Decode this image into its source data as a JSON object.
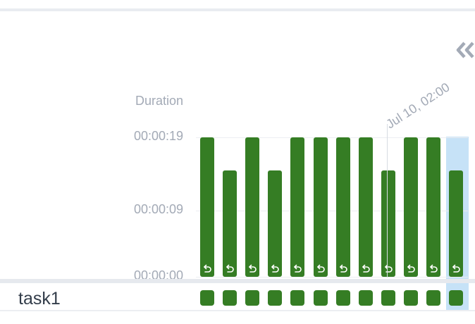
{
  "panel": {
    "collapse_icon": "double-chevron-left-icon",
    "duration_label": "Duration",
    "hover_date": "Jul 10, 02:00",
    "task_name": "task1",
    "retry_icon": "retry-icon"
  },
  "colors": {
    "success": "#357d24",
    "selection": "#c6e2f7",
    "muted_text": "#a3aab6"
  },
  "chart_data": {
    "type": "bar",
    "ylabel": "Duration",
    "y_tick_labels": [
      "00:00:19",
      "00:00:09",
      "00:00:00"
    ],
    "y_tick_seconds": [
      19,
      9,
      0
    ],
    "ylim": [
      0,
      19
    ],
    "unit": "seconds",
    "values": [
      19,
      14.5,
      19,
      14.5,
      19,
      19,
      19,
      19,
      14.5,
      19,
      19,
      14.5
    ],
    "selected_index": 11,
    "hover_index": 8,
    "grid": true,
    "legend": "none"
  }
}
